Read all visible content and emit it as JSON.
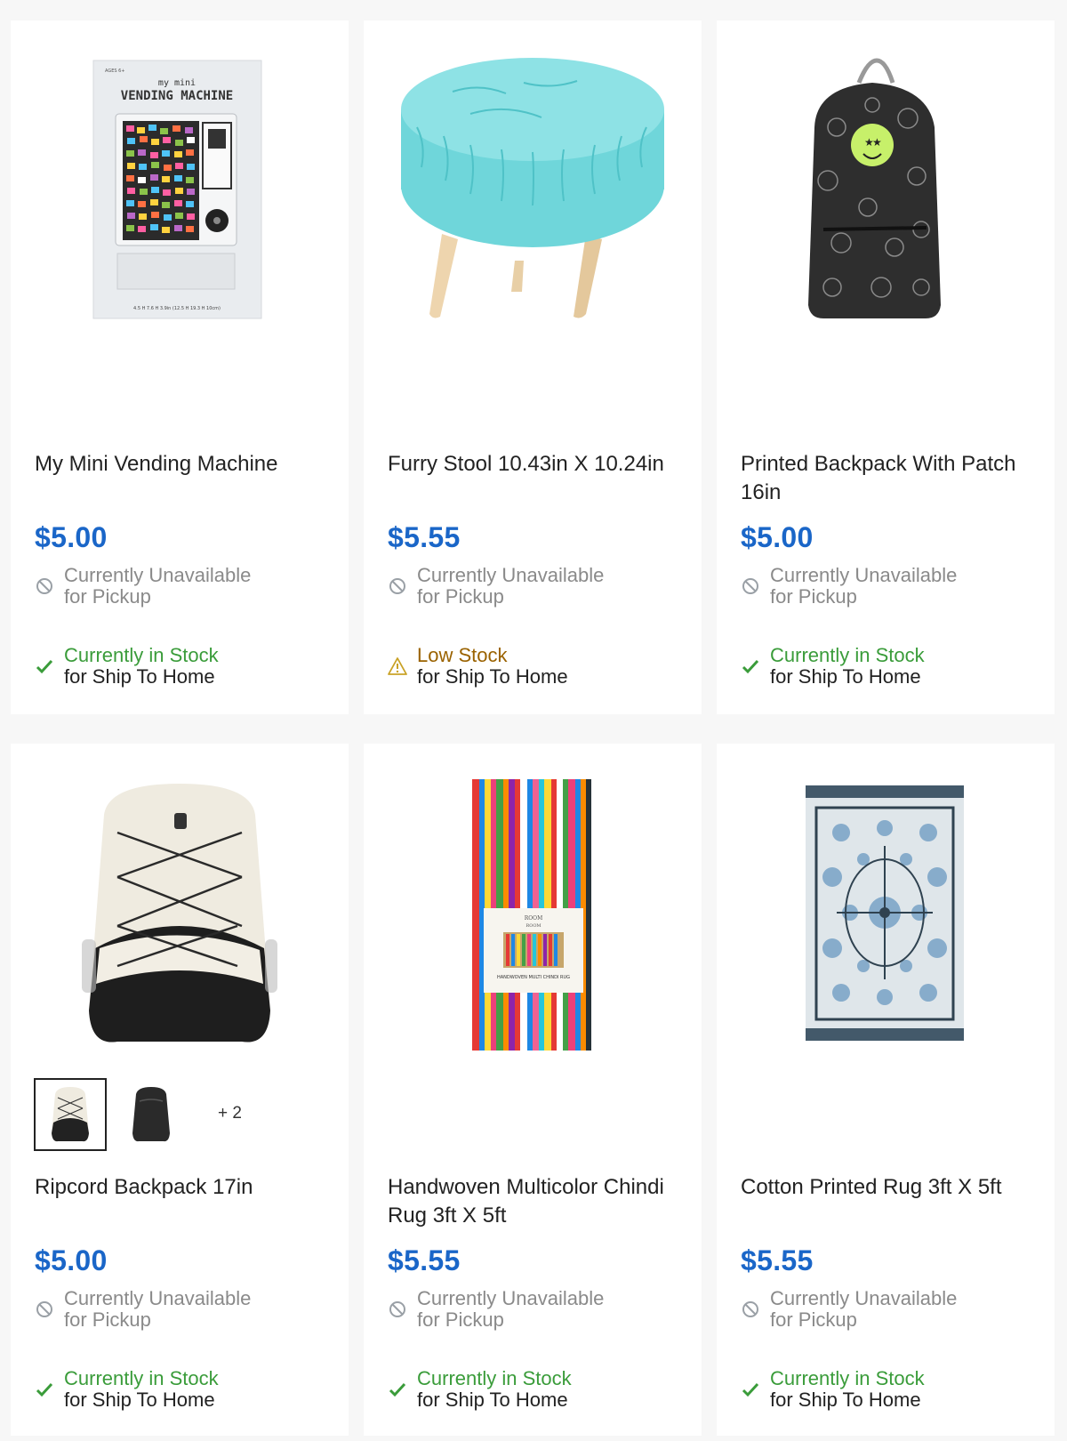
{
  "products": [
    {
      "name": "My Mini Vending Machine",
      "price": "$5.00",
      "pickup": {
        "line1": "Currently Unavailable",
        "line2": "for Pickup"
      },
      "ship": {
        "line1": "Currently in Stock",
        "line2": "for Ship To Home",
        "level": "in-stock"
      },
      "image": {
        "header_small": "AGES 6+",
        "header_top": "my mini",
        "header_main": "VENDING MACHINE",
        "footer": "4.5 H 7.6 H 3.9in (12.5 H 19.3 H 10cm)"
      }
    },
    {
      "name": "Furry Stool 10.43in X 10.24in",
      "price": "$5.55",
      "pickup": {
        "line1": "Currently Unavailable",
        "line2": "for Pickup"
      },
      "ship": {
        "line1": "Low Stock",
        "line2": "for Ship To Home",
        "level": "low-stock"
      }
    },
    {
      "name": "Printed Backpack With Patch 16in",
      "price": "$5.00",
      "pickup": {
        "line1": "Currently Unavailable",
        "line2": "for Pickup"
      },
      "ship": {
        "line1": "Currently in Stock",
        "line2": "for Ship To Home",
        "level": "in-stock"
      }
    },
    {
      "name": "Ripcord Backpack 17in",
      "price": "$5.00",
      "pickup": {
        "line1": "Currently Unavailable",
        "line2": "for Pickup"
      },
      "ship": {
        "line1": "Currently in Stock",
        "line2": "for Ship To Home",
        "level": "in-stock"
      },
      "thumbnails_more": "+ 2"
    },
    {
      "name": "Handwoven Multicolor Chindi Rug 3ft X 5ft",
      "price": "$5.55",
      "pickup": {
        "line1": "Currently Unavailable",
        "line2": "for Pickup"
      },
      "ship": {
        "line1": "Currently in Stock",
        "line2": "for Ship To Home",
        "level": "in-stock"
      },
      "image": {
        "band_top": "ROOM",
        "band_sub": "ROOM",
        "band_label": "HANDWOVEN MULTI CHINDI RUG"
      }
    },
    {
      "name": "Cotton Printed Rug 3ft X 5ft",
      "price": "$5.55",
      "pickup": {
        "line1": "Currently Unavailable",
        "line2": "for Pickup"
      },
      "ship": {
        "line1": "Currently in Stock",
        "line2": "for Ship To Home",
        "level": "in-stock"
      }
    }
  ],
  "colors": {
    "price": "#1a66c8",
    "in_stock": "#3a9c3a",
    "low_stock": "#9a6200",
    "unavailable": "#8a8a8a"
  },
  "icons": {
    "unavailable": "no-symbol-icon",
    "in_stock": "checkmark-icon",
    "low_stock": "warning-triangle-icon"
  }
}
